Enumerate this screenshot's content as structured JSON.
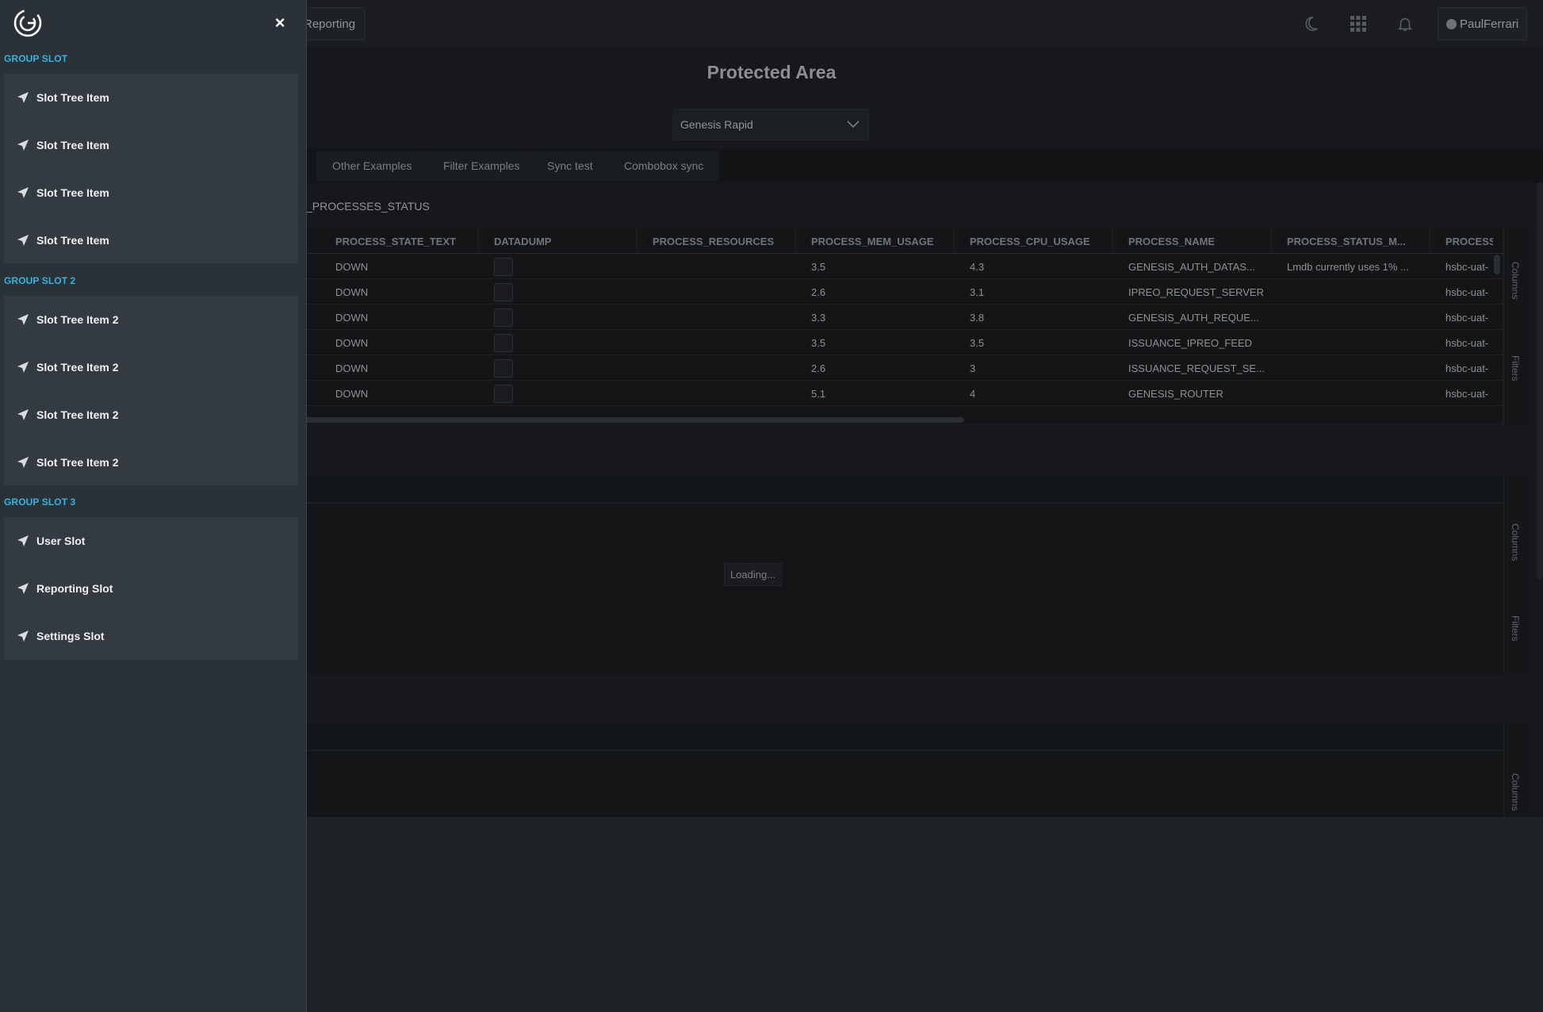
{
  "topbar": {
    "reporting_label": "Reporting",
    "user_label": "PaulFerrari",
    "icons": [
      "moon-icon",
      "apps-grid-icon",
      "bell-icon",
      "user-icon"
    ]
  },
  "page": {
    "title": "Protected Area",
    "select_value": "Genesis Rapid"
  },
  "tabs": [
    "Other Examples",
    "Filter Examples",
    "Sync test",
    "Combobox sync"
  ],
  "grid": {
    "title": "_PROCESSES_STATUS",
    "columns": [
      "PROCESS_STATE_TEXT",
      "DATADUMP",
      "PROCESS_RESOURCES",
      "PROCESS_MEM_USAGE",
      "PROCESS_CPU_USAGE",
      "PROCESS_NAME",
      "PROCESS_STATUS_M...",
      "PROCESS_H"
    ],
    "rows": [
      {
        "state": "DOWN",
        "mem": "3.5",
        "cpu": "4.3",
        "name": "GENESIS_AUTH_DATAS...",
        "status_msg": "Lmdb currently uses 1% ...",
        "host": "hsbc-uat-"
      },
      {
        "state": "DOWN",
        "mem": "2.6",
        "cpu": "3.1",
        "name": "IPREO_REQUEST_SERVER",
        "status_msg": "",
        "host": "hsbc-uat-"
      },
      {
        "state": "DOWN",
        "mem": "3.3",
        "cpu": "3.8",
        "name": "GENESIS_AUTH_REQUE...",
        "status_msg": "",
        "host": "hsbc-uat-"
      },
      {
        "state": "DOWN",
        "mem": "3.5",
        "cpu": "3.5",
        "name": "ISSUANCE_IPREO_FEED",
        "status_msg": "",
        "host": "hsbc-uat-"
      },
      {
        "state": "DOWN",
        "mem": "2.6",
        "cpu": "3",
        "name": "ISSUANCE_REQUEST_SE...",
        "status_msg": "",
        "host": "hsbc-uat-"
      },
      {
        "state": "DOWN",
        "mem": "5.1",
        "cpu": "4",
        "name": "GENESIS_ROUTER",
        "status_msg": "",
        "host": "hsbc-uat-"
      }
    ],
    "side_columns": "Columns",
    "side_filters": "Filters"
  },
  "grid2": {
    "loading": "Loading...",
    "side_columns": "Columns",
    "side_filters": "Filters"
  },
  "grid3": {
    "side_columns": "Columns"
  },
  "drawer": {
    "close_symbol": "×",
    "accent_color": "#33b3e0",
    "groups": [
      {
        "label": "GROUP SLOT",
        "items": [
          "Slot Tree Item",
          "Slot Tree Item",
          "Slot Tree Item",
          "Slot Tree Item"
        ]
      },
      {
        "label": "GROUP SLOT 2",
        "items": [
          "Slot Tree Item 2",
          "Slot Tree Item 2",
          "Slot Tree Item 2",
          "Slot Tree Item 2"
        ]
      },
      {
        "label": "GROUP SLOT 3",
        "items": [
          "User Slot",
          "Reporting Slot",
          "Settings Slot"
        ]
      }
    ]
  }
}
